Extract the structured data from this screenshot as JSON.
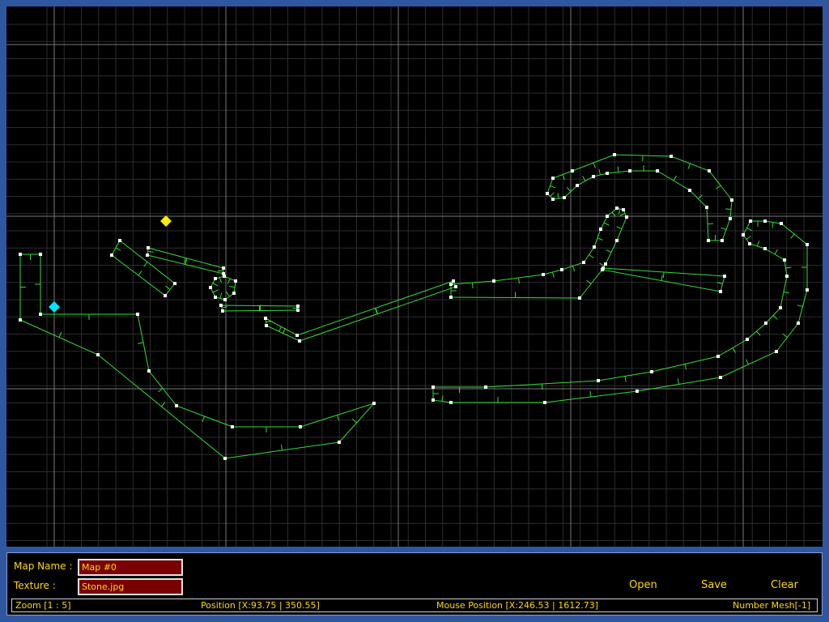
{
  "panel": {
    "map_name_label": "Map Name :",
    "map_name_value": "Map #0",
    "texture_label": "Texture :",
    "texture_value": "Stone.jpg",
    "open_label": "Open",
    "save_label": "Save",
    "clear_label": "Clear"
  },
  "status": {
    "zoom": "Zoom [1 : 5]",
    "position": "Position [X:93.75 | 350.55]",
    "mouse_position": "Mouse Position [X:246.53 | 1612.73]",
    "number_mesh": "Number Mesh[-1]"
  },
  "colors": {
    "frame": "#2f579f",
    "grid_minor": "#2d2d2d",
    "grid_major": "#777777",
    "mesh_line": "#33dd33",
    "vertex": "#ffffff",
    "marker_yellow": "#ffee00",
    "marker_cyan": "#00e5ff",
    "text": "#ffd800",
    "field_bg": "#7a0000"
  }
}
